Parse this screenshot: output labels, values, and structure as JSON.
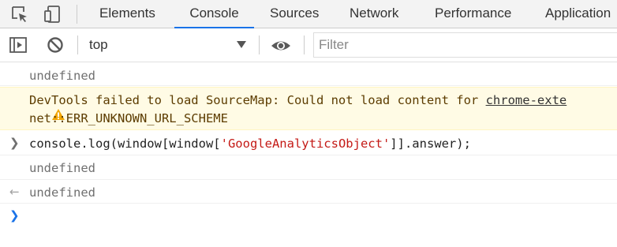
{
  "tabs": [
    {
      "label": "Elements",
      "active": false
    },
    {
      "label": "Console",
      "active": true
    },
    {
      "label": "Sources",
      "active": false
    },
    {
      "label": "Network",
      "active": false
    },
    {
      "label": "Performance",
      "active": false
    },
    {
      "label": "Application",
      "active": false
    }
  ],
  "toolbar": {
    "context": "top",
    "filter_placeholder": "Filter"
  },
  "console": {
    "line1": "undefined",
    "warning_text": "DevTools failed to load SourceMap: Could not load content for ",
    "warning_link": "chrome-exte",
    "warning_line2": "net::ERR_UNKNOWN_URL_SCHEME",
    "input_before": "console.log(window[window[",
    "input_string": "'GoogleAnalyticsObject'",
    "input_after": "]].answer);",
    "log_output": "undefined",
    "result_output": "undefined"
  },
  "colors": {
    "accent": "#1a73e8",
    "warning_bg": "#fffbe5",
    "warning_icon": "#f2a600",
    "string": "#c41a16"
  },
  "icons": [
    "inspect-icon",
    "device-toggle-icon",
    "sidebar-toggle-icon",
    "clear-console-icon",
    "eye-icon",
    "warning-icon",
    "input-chevron-icon",
    "result-arrow-icon",
    "prompt-icon"
  ]
}
